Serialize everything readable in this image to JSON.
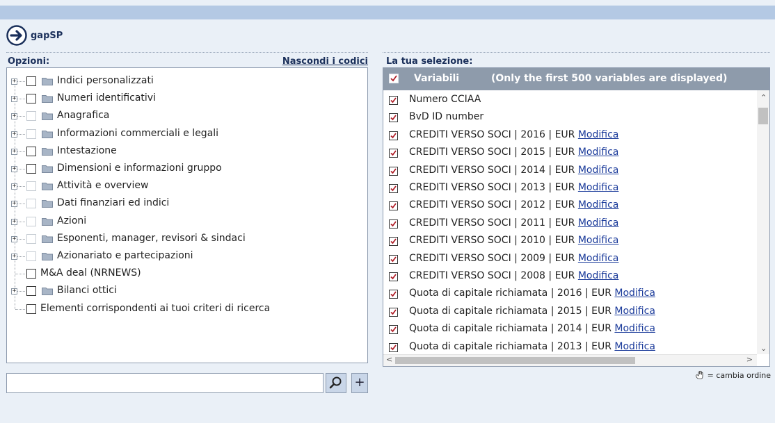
{
  "brand": {
    "label": "gapSP",
    "icon": "arrow-right-circle-icon"
  },
  "left": {
    "title": "Opzioni:",
    "toggle_codes": "Nascondi i codici",
    "tree": [
      {
        "label": "Indici personalizzati",
        "expandable": true,
        "enabled": true
      },
      {
        "label": "Numeri identificativi",
        "expandable": true,
        "enabled": true
      },
      {
        "label": "Anagrafica",
        "expandable": true,
        "enabled": false
      },
      {
        "label": "Informazioni commerciali e legali",
        "expandable": true,
        "enabled": false
      },
      {
        "label": "Intestazione",
        "expandable": true,
        "enabled": true
      },
      {
        "label": "Dimensioni e informazioni gruppo",
        "expandable": true,
        "enabled": true
      },
      {
        "label": "Attività e overview",
        "expandable": true,
        "enabled": false
      },
      {
        "label": "Dati finanziari ed indici",
        "expandable": true,
        "enabled": false
      },
      {
        "label": "Azioni",
        "expandable": true,
        "enabled": false
      },
      {
        "label": "Esponenti, manager, revisori & sindaci",
        "expandable": true,
        "enabled": false
      },
      {
        "label": "Azionariato e partecipazioni",
        "expandable": true,
        "enabled": false
      },
      {
        "label": "M&A deal (NRNEWS)",
        "expandable": false,
        "enabled": true
      },
      {
        "label": "Bilanci ottici",
        "expandable": true,
        "enabled": true
      },
      {
        "label": "Elementi corrispondenti ai tuoi criteri di ricerca",
        "expandable": false,
        "enabled": true
      }
    ]
  },
  "right": {
    "title": "La tua selezione:",
    "header": {
      "title": "Variabili",
      "note": "(Only the first 500 variables are displayed)"
    },
    "edit_label": "Modifica",
    "items": [
      {
        "text": "Numero CCIAA",
        "editable": false
      },
      {
        "text": "BvD ID number",
        "editable": false
      },
      {
        "text": "CREDITI VERSO SOCI | 2016 | EUR",
        "editable": true
      },
      {
        "text": "CREDITI VERSO SOCI | 2015 | EUR",
        "editable": true
      },
      {
        "text": "CREDITI VERSO SOCI | 2014 | EUR",
        "editable": true
      },
      {
        "text": "CREDITI VERSO SOCI | 2013 | EUR",
        "editable": true
      },
      {
        "text": "CREDITI VERSO SOCI | 2012 | EUR",
        "editable": true
      },
      {
        "text": "CREDITI VERSO SOCI | 2011 | EUR",
        "editable": true
      },
      {
        "text": "CREDITI VERSO SOCI | 2010 | EUR",
        "editable": true
      },
      {
        "text": "CREDITI VERSO SOCI | 2009 | EUR",
        "editable": true
      },
      {
        "text": "CREDITI VERSO SOCI | 2008 | EUR",
        "editable": true
      },
      {
        "text": "Quota di capitale richiamata | 2016 | EUR",
        "editable": true
      },
      {
        "text": "Quota di capitale richiamata | 2015 | EUR",
        "editable": true
      },
      {
        "text": "Quota di capitale richiamata | 2014 | EUR",
        "editable": true
      },
      {
        "text": "Quota di capitale richiamata | 2013 | EUR",
        "editable": true
      }
    ],
    "reorder_hint": "= cambia ordine"
  },
  "search": {
    "value": "",
    "placeholder": ""
  },
  "colors": {
    "accent": "#1a2f5a",
    "check": "#b0202a",
    "header_bg": "#8e9bab",
    "topbar": "#b4c9e4"
  }
}
